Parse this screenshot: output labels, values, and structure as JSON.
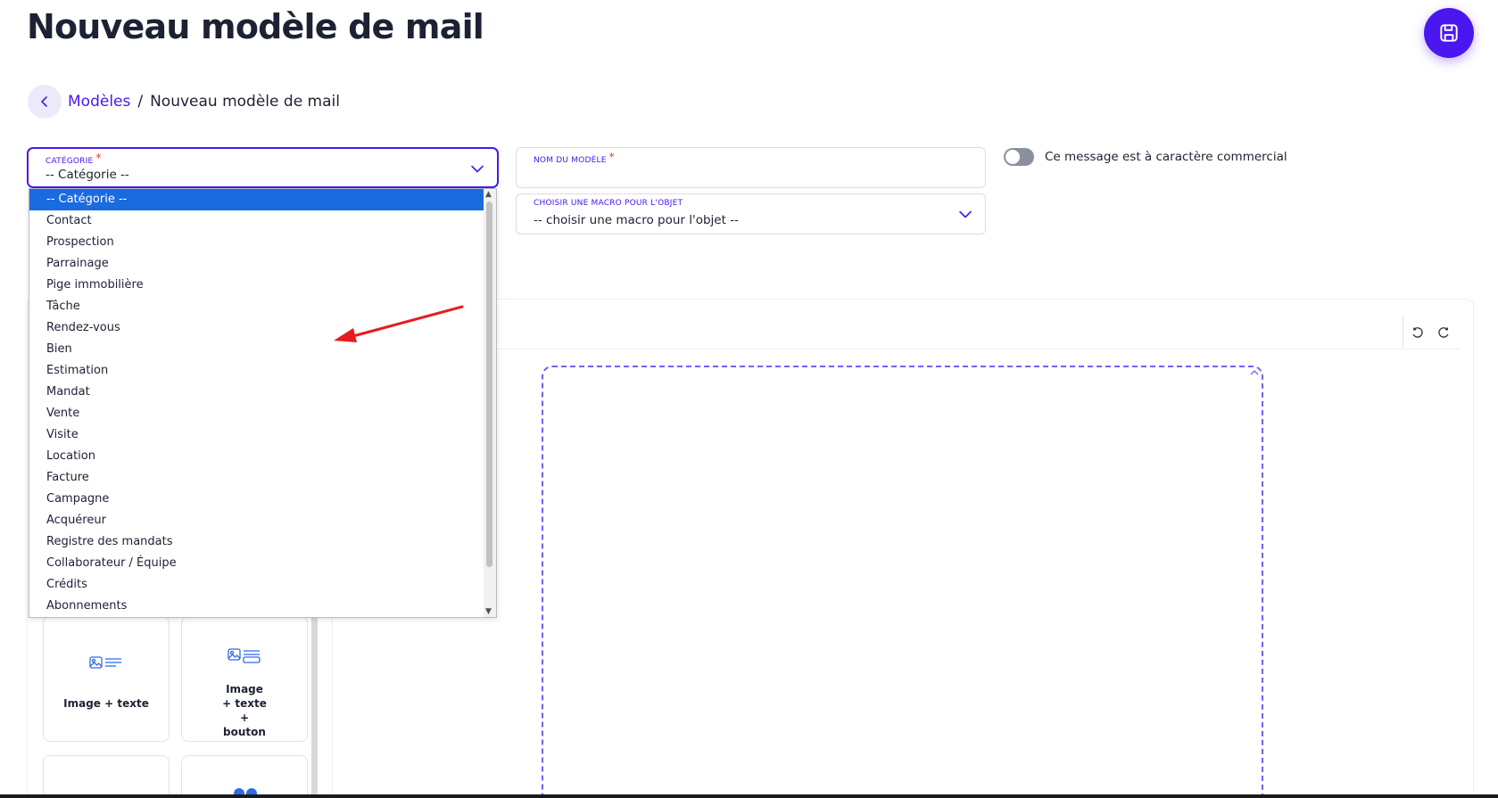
{
  "page": {
    "title": "Nouveau modèle de mail"
  },
  "breadcrumb": {
    "parent": "Modèles",
    "separator": "/",
    "current": "Nouveau modèle de mail"
  },
  "form": {
    "categorie": {
      "label": "Catégorie",
      "required_mark": "*",
      "value": "-- Catégorie --"
    },
    "nom": {
      "label": "Nom du modèle",
      "required_mark": "*",
      "value": ""
    },
    "macro": {
      "label": "Choisir une macro pour l'objet",
      "value": "-- choisir une macro pour l'objet --"
    },
    "commercial_toggle": {
      "label": "Ce message est à caractère commercial",
      "checked": false
    }
  },
  "dropdown": {
    "selected_index": 0,
    "options": [
      "-- Catégorie --",
      "Contact",
      "Prospection",
      "Parrainage",
      "Pige immobilière",
      "Tâche",
      "Rendez-vous",
      "Bien",
      "Estimation",
      "Mandat",
      "Vente",
      "Visite",
      "Location",
      "Facture",
      "Campagne",
      "Acquéreur",
      "Registre des mandats",
      "Collaborateur / Équipe",
      "Crédits",
      "Abonnements"
    ]
  },
  "blocks": [
    {
      "label": "Image + texte",
      "icon": "image-text-icon"
    },
    {
      "label": "Image + texte + bouton",
      "icon": "image-text-button-icon"
    }
  ],
  "colors": {
    "accent": "#4a17f0",
    "selected": "#1a6be0",
    "annotation": "#e81c1c",
    "required": "#e53935"
  },
  "icons": {
    "save": "save-icon",
    "back": "chevron-left-icon",
    "undo": "undo-icon",
    "redo": "redo-icon",
    "select": "chevron-down-icon"
  }
}
